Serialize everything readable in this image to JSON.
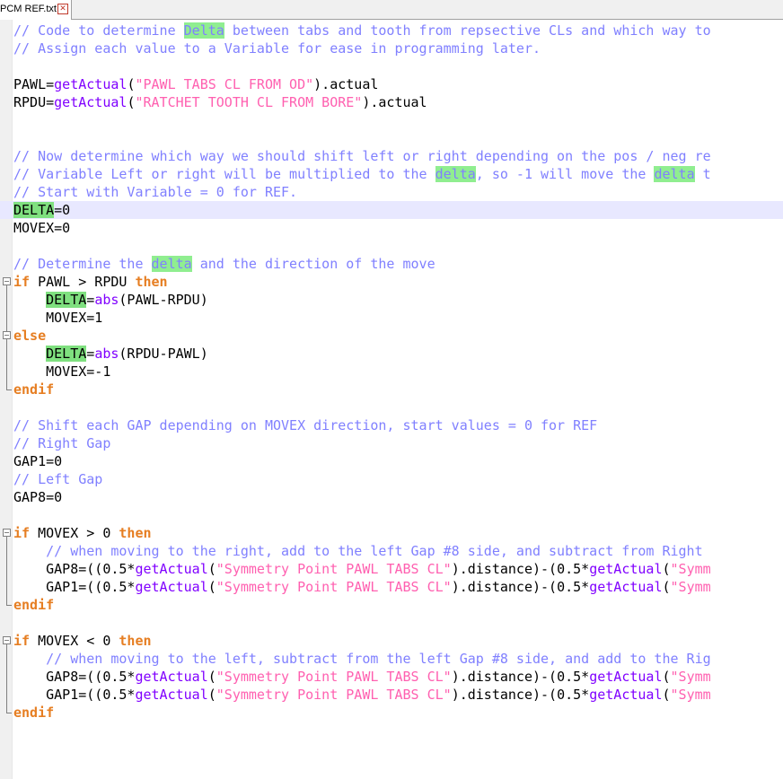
{
  "tab": {
    "title": "PCM REF.txt",
    "close_icon": "✕"
  },
  "lines": [
    [
      {
        "t": "// Code to determine ",
        "c": "cm"
      },
      {
        "t": "Delta",
        "c": "cm",
        "h": "hl2"
      },
      {
        "t": " between tabs and tooth from repsective CLs and which way to",
        "c": "cm"
      }
    ],
    [
      {
        "t": "// Assign each value to a Variable for ease in programming later.",
        "c": "cm"
      }
    ],
    [],
    [
      {
        "t": "PAWL",
        "c": "vr"
      },
      {
        "t": "=",
        "c": "op"
      },
      {
        "t": "getActual",
        "c": "fn"
      },
      {
        "t": "(",
        "c": "op"
      },
      {
        "t": "\"PAWL TABS CL FROM OD\"",
        "c": "st"
      },
      {
        "t": ").actual",
        "c": "op"
      }
    ],
    [
      {
        "t": "RPDU",
        "c": "vr"
      },
      {
        "t": "=",
        "c": "op"
      },
      {
        "t": "getActual",
        "c": "fn"
      },
      {
        "t": "(",
        "c": "op"
      },
      {
        "t": "\"RATCHET TOOTH CL FROM BORE\"",
        "c": "st"
      },
      {
        "t": ").actual",
        "c": "op"
      }
    ],
    [],
    [],
    [
      {
        "t": "// Now determine which way we should shift left or right depending on the pos / neg re",
        "c": "cm"
      }
    ],
    [
      {
        "t": "// Variable Left or right will be multiplied to the ",
        "c": "cm"
      },
      {
        "t": "delta",
        "c": "cm",
        "h": "hl2"
      },
      {
        "t": ", so -1 will move the ",
        "c": "cm"
      },
      {
        "t": "delta",
        "c": "cm",
        "h": "hl2"
      },
      {
        "t": " t",
        "c": "cm"
      }
    ],
    [
      {
        "t": "// Start with Variable = 0 for REF.",
        "c": "cm"
      }
    ],
    [
      {
        "t": "DELTA",
        "c": "vr",
        "h": "hl"
      },
      {
        "t": "=0",
        "c": "op"
      }
    ],
    [
      {
        "t": "MOVEX",
        "c": "vr"
      },
      {
        "t": "=0",
        "c": "op"
      }
    ],
    [],
    [
      {
        "t": "// Determine the ",
        "c": "cm"
      },
      {
        "t": "delta",
        "c": "cm",
        "h": "hl2"
      },
      {
        "t": " and the direction of the move",
        "c": "cm"
      }
    ],
    [
      {
        "t": "if",
        "c": "kw"
      },
      {
        "t": " PAWL ",
        "c": "op"
      },
      {
        "t": ">",
        "c": "op"
      },
      {
        "t": " RPDU ",
        "c": "op"
      },
      {
        "t": "then",
        "c": "kw"
      }
    ],
    [
      {
        "t": "    ",
        "c": "op"
      },
      {
        "t": "DELTA",
        "c": "vr",
        "h": "hl"
      },
      {
        "t": "=",
        "c": "op"
      },
      {
        "t": "abs",
        "c": "fn"
      },
      {
        "t": "(PAWL-RPDU)",
        "c": "op"
      }
    ],
    [
      {
        "t": "    MOVEX=1",
        "c": "op"
      }
    ],
    [
      {
        "t": "else",
        "c": "kw"
      }
    ],
    [
      {
        "t": "    ",
        "c": "op"
      },
      {
        "t": "DELTA",
        "c": "vr",
        "h": "hl"
      },
      {
        "t": "=",
        "c": "op"
      },
      {
        "t": "abs",
        "c": "fn"
      },
      {
        "t": "(RPDU-PAWL)",
        "c": "op"
      }
    ],
    [
      {
        "t": "    MOVEX=-1",
        "c": "op"
      }
    ],
    [
      {
        "t": "endif",
        "c": "kw"
      }
    ],
    [],
    [
      {
        "t": "// Shift each GAP depending on MOVEX direction, start values = 0 for REF",
        "c": "cm"
      }
    ],
    [
      {
        "t": "// Right Gap",
        "c": "cm"
      }
    ],
    [
      {
        "t": "GAP1=0",
        "c": "op"
      }
    ],
    [
      {
        "t": "// Left Gap",
        "c": "cm"
      }
    ],
    [
      {
        "t": "GAP8=0",
        "c": "op"
      }
    ],
    [],
    [
      {
        "t": "if",
        "c": "kw"
      },
      {
        "t": " MOVEX ",
        "c": "op"
      },
      {
        "t": ">",
        "c": "op"
      },
      {
        "t": " 0 ",
        "c": "op"
      },
      {
        "t": "then",
        "c": "kw"
      }
    ],
    [
      {
        "t": "    // when moving to the right, add to the left Gap #8 side, and subtract from Right",
        "c": "cm"
      }
    ],
    [
      {
        "t": "    GAP8=((0.5*",
        "c": "op"
      },
      {
        "t": "getActual",
        "c": "fn"
      },
      {
        "t": "(",
        "c": "op"
      },
      {
        "t": "\"Symmetry Point PAWL TABS CL\"",
        "c": "st"
      },
      {
        "t": ").distance)-(0.5*",
        "c": "op"
      },
      {
        "t": "getActual",
        "c": "fn"
      },
      {
        "t": "(",
        "c": "op"
      },
      {
        "t": "\"Symm",
        "c": "st"
      }
    ],
    [
      {
        "t": "    GAP1=((0.5*",
        "c": "op"
      },
      {
        "t": "getActual",
        "c": "fn"
      },
      {
        "t": "(",
        "c": "op"
      },
      {
        "t": "\"Symmetry Point PAWL TABS CL\"",
        "c": "st"
      },
      {
        "t": ").distance)-(0.5*",
        "c": "op"
      },
      {
        "t": "getActual",
        "c": "fn"
      },
      {
        "t": "(",
        "c": "op"
      },
      {
        "t": "\"Symm",
        "c": "st"
      }
    ],
    [
      {
        "t": "endif",
        "c": "kw"
      }
    ],
    [],
    [
      {
        "t": "if",
        "c": "kw"
      },
      {
        "t": " MOVEX ",
        "c": "op"
      },
      {
        "t": "<",
        "c": "op"
      },
      {
        "t": " 0 ",
        "c": "op"
      },
      {
        "t": "then",
        "c": "kw"
      }
    ],
    [
      {
        "t": "    // when moving to the left, subtract from the left Gap #8 side, and add to the Rig",
        "c": "cm"
      }
    ],
    [
      {
        "t": "    GAP8=((0.5*",
        "c": "op"
      },
      {
        "t": "getActual",
        "c": "fn"
      },
      {
        "t": "(",
        "c": "op"
      },
      {
        "t": "\"Symmetry Point PAWL TABS CL\"",
        "c": "st"
      },
      {
        "t": ").distance)-(0.5*",
        "c": "op"
      },
      {
        "t": "getActual",
        "c": "fn"
      },
      {
        "t": "(",
        "c": "op"
      },
      {
        "t": "\"Symm",
        "c": "st"
      }
    ],
    [
      {
        "t": "    GAP1=((0.5*",
        "c": "op"
      },
      {
        "t": "getActual",
        "c": "fn"
      },
      {
        "t": "(",
        "c": "op"
      },
      {
        "t": "\"Symmetry Point PAWL TABS CL\"",
        "c": "st"
      },
      {
        "t": ").distance)-(0.5*",
        "c": "op"
      },
      {
        "t": "getActual",
        "c": "fn"
      },
      {
        "t": "(",
        "c": "op"
      },
      {
        "t": "\"Symm",
        "c": "st"
      }
    ],
    [
      {
        "t": "endif",
        "c": "kw"
      }
    ]
  ],
  "current_line": 10,
  "folds": [
    {
      "start": 14,
      "end": 16,
      "mid": [
        17
      ],
      "close": 20
    },
    {
      "start": 28,
      "close": 32
    },
    {
      "start": 34,
      "close": 38
    }
  ]
}
